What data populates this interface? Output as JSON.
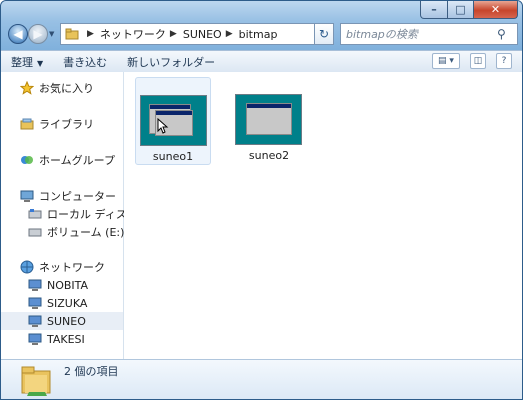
{
  "window": {
    "controls": {
      "minimize": "–",
      "maximize": "□",
      "close": "✕"
    }
  },
  "address_bar": {
    "crumbs": [
      "ネットワーク",
      "SUNEO",
      "bitmap"
    ]
  },
  "search": {
    "placeholder": "bitmapの検索"
  },
  "toolbar": {
    "organize": "整理",
    "burn": "書き込む",
    "new_folder": "新しいフォルダー"
  },
  "nav_pane": {
    "favorites": "お気に入り",
    "libraries": "ライブラリ",
    "homegroup": "ホームグループ",
    "computer": "コンピューター",
    "local_disk": "ローカル ディスク (",
    "volume": "ボリューム (E:)",
    "network": "ネットワーク",
    "hosts": [
      "NOBITA",
      "SIZUKA",
      "SUNEO",
      "TAKESI"
    ],
    "selected_host": "SUNEO"
  },
  "files": [
    {
      "name": "suneo1",
      "selected": true
    },
    {
      "name": "suneo2",
      "selected": false
    }
  ],
  "status_bar": {
    "item_count": "2 個の項目"
  },
  "colors": {
    "frame": "#7fb0dc",
    "selection": "#e8eef6",
    "thumbnail_desktop": "#00808a"
  }
}
